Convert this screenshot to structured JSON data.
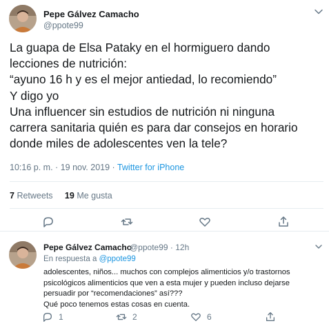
{
  "tweet": {
    "author_name": "Pepe Gálvez Camacho",
    "author_handle": "@ppote99",
    "text": "La guapa de Elsa Pataky en el hormiguero dando\nlecciones de nutrición:\n“ayuno 16 h y es el mejor antiedad, lo recomiendo”\nY digo yo\nUna influencer sin estudios de nutrición ni ninguna\ncarrera sanitaria quién es para dar consejos en horario\ndonde miles de adolescentes ven la tele?",
    "time": "10:16 p. m.",
    "date": "19 nov. 2019",
    "separator": "·",
    "source": "Twitter for iPhone",
    "retweets_count": "7",
    "retweets_label": "Retweets",
    "likes_count": "19",
    "likes_label": "Me gusta"
  },
  "reply": {
    "author_name": "Pepe Gálvez Camacho",
    "author_handle": "@ppote99",
    "time_ago": "12h",
    "separator": "·",
    "in_reply_prefix": "En respuesta a",
    "in_reply_mention": "@ppote99",
    "text": "adolescentes, niños... muchos con complejos alimenticios y/o trastornos\npsicológicos alimenticios que ven a esta mujer y pueden incluso dejarse\npersuadir por “recomendaciones” así???\nQué poco tenemos estas cosas en cuenta.",
    "reply_count": "1",
    "retweet_count": "2",
    "like_count": "6"
  },
  "colors": {
    "accent": "#1b95e0",
    "secondary_text": "#657786",
    "divider": "#e6ecf0"
  },
  "icons": [
    "chevron-down-icon",
    "reply-icon",
    "retweet-icon",
    "like-icon",
    "share-icon"
  ]
}
